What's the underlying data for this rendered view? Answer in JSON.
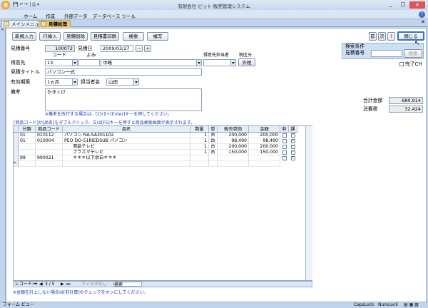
{
  "app": {
    "title": "有限会社 ビット 販売管理システム",
    "ribbon_tabs": [
      "ホーム",
      "作成",
      "外部データ",
      "データベース ツール"
    ]
  },
  "doc_tabs": [
    {
      "label": "メインメニュー"
    },
    {
      "label": "見積処理"
    }
  ],
  "toolbar": {
    "new_entry": "新規入力",
    "row_insert": "行挿入",
    "row_delete": "見積削除",
    "print": "見積書印刷",
    "search": "検索",
    "copy": "複写"
  },
  "nav": {
    "prev": "前",
    "next": "次",
    "help": "?",
    "close": "閉じる"
  },
  "search_panel": {
    "title": "検索条件",
    "field_label": "見積番号",
    "button": "検索"
  },
  "form": {
    "estimate_no_label": "見積番号",
    "estimate_no": "100072",
    "estimate_date_label": "見積日",
    "estimate_date": "2009/03/27",
    "minus": "－",
    "plus": "＋",
    "code_header": "コード",
    "reading_header": "よみ",
    "customer_label": "得意先",
    "customer_code": "13",
    "customer_name": "中嶋",
    "contact_label": "得意先担当者",
    "tax_label": "税区分",
    "tax_value": "外税",
    "title_label": "見積タイトル",
    "title_value": "パソコン一式",
    "validity_label": "有効期限",
    "validity_value": "1ヵ月",
    "staff_label": "担当者名",
    "staff_value": "山田",
    "remarks_label": "備考",
    "remarks_value": "かきくけ",
    "remarks_hint": "※備考を改行する場合は、[Ctrl]+[Enter]キーを押してください。",
    "done_label": "完了CH"
  },
  "totals": {
    "total_label": "合計金額",
    "total_value": "680,914",
    "tax_label": "消費税",
    "tax_value": "32,424"
  },
  "grid_hint": "[商品コード]か[品名]をダブルクリック、又は[F5]キーを押すと商品検索画面が表示されます。",
  "grid": {
    "headers": [
      "分類",
      "商品コード",
      "品名",
      "数量",
      "単",
      "販売単価",
      "金額",
      "非",
      "課"
    ],
    "rows": [
      {
        "cat": "01",
        "code": "010112",
        "name": "パソコン NA-SA301102",
        "qty": "1",
        "unit": "台",
        "price": "200,000",
        "amount": "200,000",
        "non": false,
        "tax": true
      },
      {
        "cat": "01",
        "code": "010004",
        "name": "PEO DO-51RIEDSUB パソコン",
        "qty": "1",
        "unit": "台",
        "price": "98,490",
        "amount": "98,490",
        "non": false,
        "tax": true
      },
      {
        "cat": "",
        "code": "",
        "name": "液晶テレビ",
        "qty": "1",
        "unit": "台",
        "price": "200,000",
        "amount": "200,000",
        "non": false,
        "tax": true
      },
      {
        "cat": "",
        "code": "",
        "name": "プラズマテレビ",
        "qty": "1",
        "unit": "台",
        "price": "150,000",
        "amount": "150,000",
        "non": false,
        "tax": true
      },
      {
        "cat": "99",
        "code": "990021",
        "name": "＊＊＊以下余白＊＊＊",
        "qty": "",
        "unit": "",
        "price": "",
        "amount": "",
        "non": false,
        "tax": true
      }
    ]
  },
  "record_nav": {
    "label": "レコード:",
    "position": "3 / 5",
    "filter": "フィルタなし",
    "search": "検索"
  },
  "footer_note": "※金額を計上しない場合は[非計算]のチェックをオンにしてください。",
  "statusbar": {
    "left": "フォーム ビュー",
    "caps": "CapsLock",
    "num": "NumLock"
  }
}
